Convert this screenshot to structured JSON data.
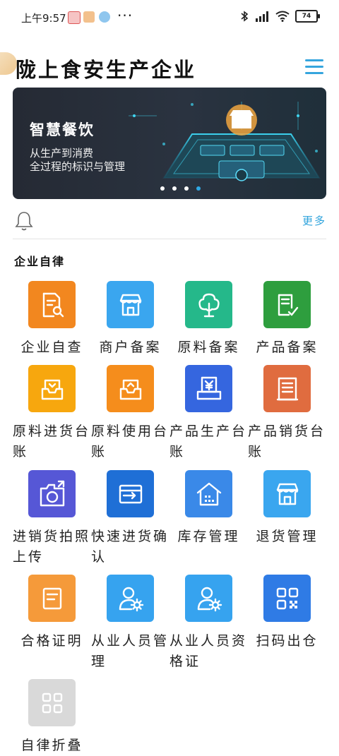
{
  "status_bar": {
    "time": "上午9:57",
    "battery": "74"
  },
  "header": {
    "title": "陇上食安生产企业"
  },
  "banner": {
    "title": "智慧餐饮",
    "line1": "从生产到消费",
    "line2": "全过程的标识与管理",
    "slides": 4,
    "active_slide": 4
  },
  "notice": {
    "more": "更多"
  },
  "section": {
    "title": "企业自律"
  },
  "tiles": [
    {
      "label": "企业自查",
      "icon": "document-search-icon",
      "color": "#f2871f"
    },
    {
      "label": "商户备案",
      "icon": "shop-icon",
      "color": "#3aa6ef"
    },
    {
      "label": "原料备案",
      "icon": "tree-icon",
      "color": "#25b88a"
    },
    {
      "label": "产品备案",
      "icon": "document-check-icon",
      "color": "#2e9e3e"
    },
    {
      "label": "原料进货台账",
      "icon": "tray-in-icon",
      "color": "#f7a70e"
    },
    {
      "label": "原料使用台账",
      "icon": "tray-out-icon",
      "color": "#f58d1c"
    },
    {
      "label": "产品生产台账",
      "icon": "receipt-yuan-icon",
      "color": "#3566df"
    },
    {
      "label": "产品销货台账",
      "icon": "ledger-icon",
      "color": "#e06c3f"
    },
    {
      "label": "进销货拍照上传",
      "icon": "camera-icon",
      "color": "#5657d6"
    },
    {
      "label": "快速进货确认",
      "icon": "card-arrow-icon",
      "color": "#1f6fd6"
    },
    {
      "label": "库存管理",
      "icon": "warehouse-icon",
      "color": "#3a89e8"
    },
    {
      "label": "退货管理",
      "icon": "shop-icon",
      "color": "#3aa6ef"
    },
    {
      "label": "合格证明",
      "icon": "certificate-icon",
      "color": "#f59a3a"
    },
    {
      "label": "从业人员管理",
      "icon": "user-gear-icon",
      "color": "#36a3ef"
    },
    {
      "label": "从业人员资格证",
      "icon": "user-gear-icon",
      "color": "#36a3ef"
    },
    {
      "label": "扫码出仓",
      "icon": "qr-code-icon",
      "color": "#2f7be5"
    },
    {
      "label": "自律折叠",
      "icon": "grid-icon",
      "color": "#d9d9d9"
    }
  ]
}
